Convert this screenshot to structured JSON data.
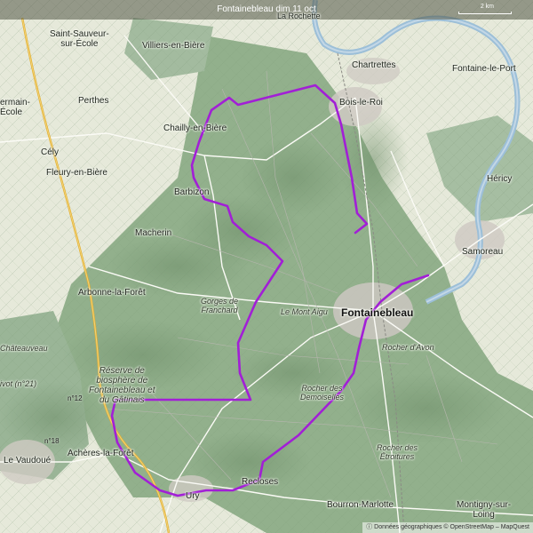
{
  "header": {
    "title": "Fontainebleau dim 11 oct"
  },
  "scale": {
    "label": "2 km"
  },
  "attribution": "ⓘ Données géographiques © OpenStreetMap – MapQuest",
  "route_color": "#a21fd6",
  "colors": {
    "forest": "#8fae8a",
    "fields": "#e7eadc",
    "river": "#9cbfd8",
    "town": "#c9c4bd",
    "motorway": "#e3b030"
  },
  "places": {
    "la_rochette": "La Rochette",
    "saint_sauveur_1": "Saint-Sauveur-",
    "saint_sauveur_2": "sur-École",
    "villiers": "Villiers-en-Bière",
    "chartrettes": "Chartrettes",
    "fontaine_le_port": "Fontaine-le-Port",
    "dammarie_1": "ermain-",
    "dammarie_2": "École",
    "perthes": "Perthes",
    "bois_le_roi": "Bois-le-Roi",
    "chailly": "Chailly-en-Bière",
    "cely": "Cély",
    "fleury": "Fleury-en-Bière",
    "hericy": "Héricy",
    "barbizon": "Barbizon",
    "macherin": "Macherin",
    "samoreau": "Samoreau",
    "arbonne": "Arbonne-la-Forêt",
    "gorges_1": "Gorges de",
    "gorges_2": "Franchard",
    "mont_aigu": "Le Mont Aigu",
    "fontainebleau": "Fontainebleau",
    "chateauveau": "Châteauveau",
    "rocher_avon": "Rocher d'Avon",
    "reserve_1": "Réserve de",
    "reserve_2": "biosphère de",
    "reserve_3": "Fontainebleau et",
    "reserve_4": "du Gâtinais",
    "rivot": "ivot (n°21)",
    "n12": "n°12",
    "rocher_dem_1": "Rocher des",
    "rocher_dem_2": "Demoiselles",
    "n18": "n°18",
    "le_vaudoue": "Le Vaudoué",
    "acheres": "Achères-la-Forêt",
    "rocher_etr_1": "Rocher des",
    "rocher_etr_2": "Étroitures",
    "recloses": "Recloses",
    "ury": "Ury",
    "bourron": "Bourron-Marlotte",
    "montigny_1": "Montigny-sur-",
    "montigny_2": "Loing"
  }
}
